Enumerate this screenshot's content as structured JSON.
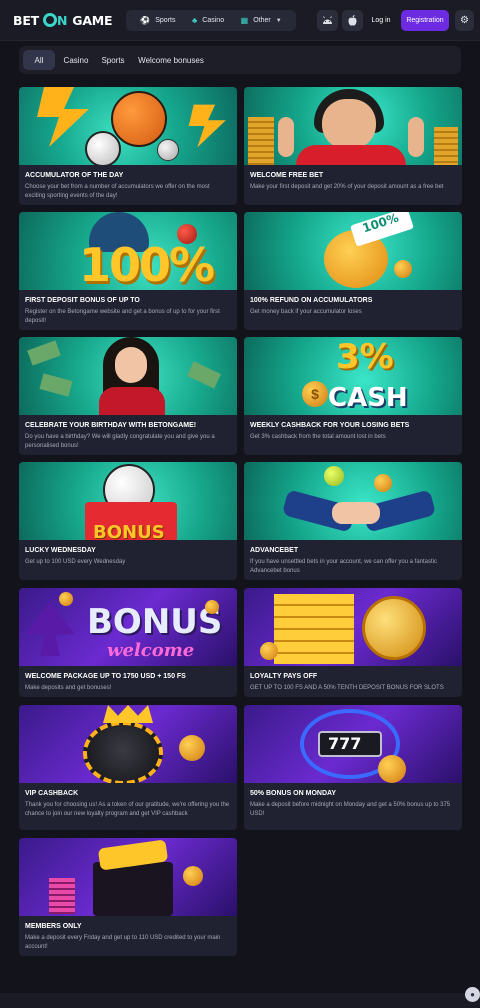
{
  "header": {
    "logo": {
      "bet": "BET",
      "on_ring": "O",
      "on_n": "N",
      "game": "GAME"
    },
    "nav": [
      {
        "label": "Sports",
        "icon": "soccer-ball-icon"
      },
      {
        "label": "Casino",
        "icon": "dice-icon"
      },
      {
        "label": "Other",
        "icon": "grid-icon"
      }
    ],
    "android_icon": "android-icon",
    "apple_icon": "apple-icon",
    "login_label": "Log in",
    "register_label": "Registration",
    "settings_icon": "gear-icon"
  },
  "filters": [
    {
      "label": "All",
      "active": true
    },
    {
      "label": "Casino",
      "active": false
    },
    {
      "label": "Sports",
      "active": false
    },
    {
      "label": "Welcome bonuses",
      "active": false
    }
  ],
  "cards": [
    {
      "title": "ACCUMULATOR OF THE DAY",
      "desc": "Choose your bet from a number of accumulators we offer on the most exciting sporting events of the day!"
    },
    {
      "title": "WELCOME FREE BET",
      "desc": "Make your first deposit and get 20% of your deposit amount as a free bet"
    },
    {
      "title": "FIRST DEPOSIT BONUS OF UP TO",
      "desc": "Register on the Betongame website and get a bonus of up to for your first deposit!",
      "image_text": "100%"
    },
    {
      "title": "100% REFUND ON ACCUMULATORS",
      "desc": "Get money back if your accumulator loses",
      "image_text": "100%"
    },
    {
      "title": "CELEBRATE YOUR BIRTHDAY WITH BETONGAME!",
      "desc": "Do you have a birthday? We will gladly congratulate you and give you a personalised bonus!"
    },
    {
      "title": "WEEKLY CASHBACK FOR YOUR LOSING BETS",
      "desc": "Get 3% cashback from the total amount lost in bets",
      "image_text": "3%",
      "image_text2": "CASH"
    },
    {
      "title": "LUCKY WEDNESDAY",
      "desc": "Get up to 100 USD every Wednesday",
      "image_text": "BONUS"
    },
    {
      "title": "ADVANCEBET",
      "desc": "If you have unsettled bets in your account, we can offer you a fantastic Advancebet bonus"
    },
    {
      "title": "WELCOME PACKAGE UP TO 1750 USD + 150 FS",
      "desc": "Make deposits and get bonuses!",
      "image_text": "BONUS",
      "image_text2": "welcome"
    },
    {
      "title": "LOYALTY PAYS OFF",
      "desc": "GET UP TO 100 FS AND A 50% TENTH DEPOSIT BONUS FOR SLOTS"
    },
    {
      "title": "VIP CASHBACK",
      "desc": "Thank you for choosing us! As a token of our gratitude, we're offering you the chance to join our new loyalty program and get VIP cashback"
    },
    {
      "title": "50% BONUS ON MONDAY",
      "desc": "Make a deposit before midnight on Monday and get a 50% bonus up to 375 USD!",
      "image_text": "777"
    },
    {
      "title": "MEMBERS ONLY",
      "desc": "Make a deposit every Friday and get up to 110 USD credited to your main account!"
    }
  ],
  "colors": {
    "accent": "#3ad6c9",
    "register": "#6c2be0",
    "background": "#12131b",
    "card": "#202231"
  },
  "chat_icon": "user-chat-icon"
}
